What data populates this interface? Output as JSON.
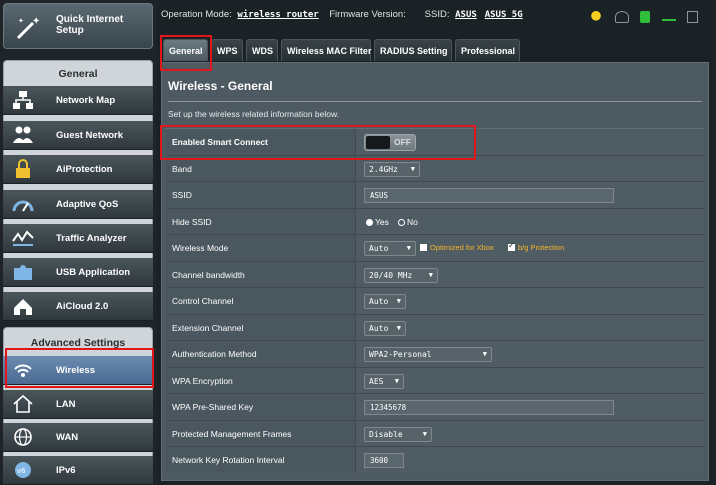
{
  "sidebar": {
    "quick_setup_label": "Quick Internet Setup",
    "general_header": "General",
    "general_items": [
      {
        "label": "Network Map"
      },
      {
        "label": "Guest Network"
      },
      {
        "label": "AiProtection"
      },
      {
        "label": "Adaptive QoS"
      },
      {
        "label": "Traffic Analyzer"
      },
      {
        "label": "USB Application"
      },
      {
        "label": "AiCloud 2.0"
      }
    ],
    "advanced_header": "Advanced Settings",
    "advanced_items": [
      {
        "label": "Wireless",
        "active": true
      },
      {
        "label": "LAN"
      },
      {
        "label": "WAN"
      },
      {
        "label": "IPv6"
      }
    ]
  },
  "topbar": {
    "operation_mode_label": "Operation Mode:",
    "operation_mode_value": "wireless router",
    "firmware_label": "Firmware Version:",
    "ssid_label": "SSID:",
    "ssid_values": [
      "ASUS",
      "ASUS_5G"
    ]
  },
  "tabs": [
    "General",
    "WPS",
    "WDS",
    "Wireless MAC Filter",
    "RADIUS Setting",
    "Professional"
  ],
  "page": {
    "title": "Wireless - General",
    "description": "Set up the wireless related information below."
  },
  "form": {
    "smart_connect": {
      "label": "Enabled Smart Connect",
      "state": "OFF"
    },
    "band": {
      "label": "Band",
      "value": "2.4GHz"
    },
    "ssid": {
      "label": "SSID",
      "value": "ASUS"
    },
    "hide_ssid": {
      "label": "Hide SSID",
      "yes": "Yes",
      "no": "No"
    },
    "wireless_mode": {
      "label": "Wireless Mode",
      "value": "Auto",
      "opt_xbox": "Optimized for Xbox",
      "opt_bg": "b/g Protection"
    },
    "channel_bandwidth": {
      "label": "Channel bandwidth",
      "value": "20/40 MHz"
    },
    "control_channel": {
      "label": "Control Channel",
      "value": "Auto"
    },
    "extension_channel": {
      "label": "Extension Channel",
      "value": "Auto"
    },
    "auth_method": {
      "label": "Authentication Method",
      "value": "WPA2-Personal"
    },
    "wpa_encryption": {
      "label": "WPA Encryption",
      "value": "AES"
    },
    "wpa_key": {
      "label": "WPA Pre-Shared Key",
      "value": "12345678"
    },
    "pmf": {
      "label": "Protected Management Frames",
      "value": "Disable"
    },
    "key_rotation": {
      "label": "Network Key Rotation Interval",
      "value": "3600"
    }
  },
  "colors": {
    "highlight": "#e0161c",
    "option_text": "#f6b52c",
    "active_menu": "#5a7aa0"
  }
}
